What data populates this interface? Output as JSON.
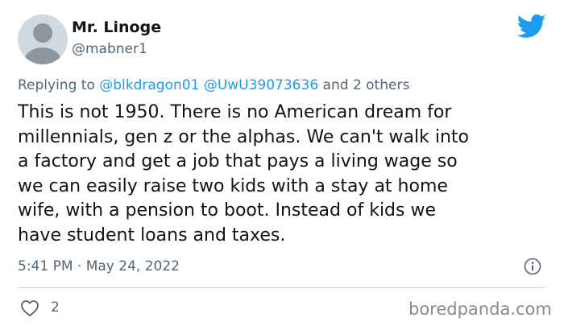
{
  "tweet": {
    "author": {
      "display_name": "Mr. Linoge",
      "handle": "@mabner1"
    },
    "reply": {
      "prefix": "Replying to",
      "mention_1": "@blkdragon01",
      "mention_2": "@UwU39073636",
      "suffix": "and 2 others"
    },
    "text": "This is not 1950. There is no American dream for\nmillennials, gen z or the alphas. We can't walk into\na factory and get a job that pays a living wage so\nwe can easily raise two kids with a stay at home\nwife, with a pension to boot. Instead of kids we\nhave student loans and taxes.",
    "timestamp": "5:41 PM · May 24, 2022",
    "like_count": "2"
  },
  "watermark": "boredpanda.com",
  "icons": {
    "logo": "twitter-bird-icon",
    "info": "info-icon",
    "like": "heart-icon",
    "avatar": "default-avatar-icon"
  },
  "colors": {
    "accent": "#1d9bf0",
    "text": "#0f1419",
    "secondary": "#536471",
    "avatar_bg": "#cfd9de",
    "avatar_fg": "#8c97a0"
  }
}
